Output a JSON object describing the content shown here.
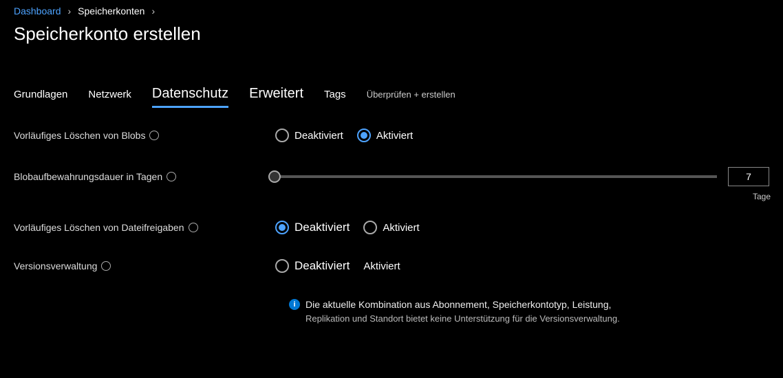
{
  "breadcrumb": {
    "dashboard": "Dashboard",
    "storage_accounts": "Speicherkonten"
  },
  "page_title": "Speicherkonto erstellen",
  "tabs": {
    "grundlagen": "Grundlagen",
    "netzwerk": "Netzwerk",
    "datenschutz": "Datenschutz",
    "erweitert": "Erweitert",
    "tags": "Tags",
    "review": "Überprüfen + erstellen"
  },
  "labels": {
    "soft_delete_blobs": "Vorläufiges Löschen von Blobs",
    "blob_retention": "Blobaufbewahrungsdauer in Tagen",
    "soft_delete_shares": "Vorläufiges Löschen von Dateifreigaben",
    "versioning": "Versionsverwaltung"
  },
  "options": {
    "deaktiviert": "Deaktiviert",
    "aktiviert": "Aktiviert"
  },
  "slider": {
    "value": "7",
    "unit": "Tage"
  },
  "info_message": {
    "line1": "Die aktuelle Kombination aus Abonnement, Speicherkontotyp, Leistung,",
    "line2": "Replikation und Standort bietet keine Unterstützung für die Versionsverwaltung."
  }
}
